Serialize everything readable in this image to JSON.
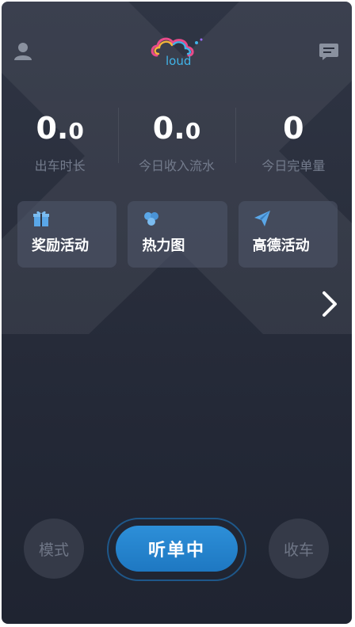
{
  "header": {
    "logo_text": "loud",
    "user_icon": "user-icon",
    "message_icon": "message-icon"
  },
  "stats": [
    {
      "value_int": "0.",
      "value_dec": "0",
      "label": "出车时长"
    },
    {
      "value_int": "0.",
      "value_dec": "0",
      "label": "今日收入流水"
    },
    {
      "value_int": "0",
      "value_dec": "",
      "label": "今日完单量"
    }
  ],
  "features": [
    {
      "label": "奖励活动",
      "icon": "gift-icon"
    },
    {
      "label": "热力图",
      "icon": "heatmap-icon"
    },
    {
      "label": "高德活动",
      "icon": "paper-plane-icon"
    }
  ],
  "bottom": {
    "mode_label": "模式",
    "listen_label": "听单中",
    "stop_label": "收车"
  },
  "colors": {
    "accent": "#1e78c2",
    "background": "#2a2f3d",
    "card": "#4a5266",
    "muted_text": "#737b8c",
    "icon_blue": "#5aa7e8"
  }
}
